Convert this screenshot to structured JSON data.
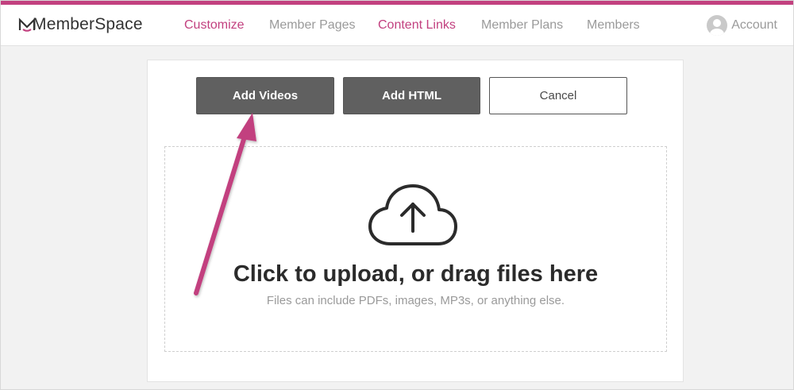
{
  "brand": {
    "name": "MemberSpace",
    "accent_color": "#c2407f"
  },
  "nav": {
    "items": [
      {
        "label": "Customize",
        "active": true
      },
      {
        "label": "Member Pages",
        "active": false
      },
      {
        "label": "Content Links",
        "active": true
      },
      {
        "label": "Member Plans",
        "active": false
      },
      {
        "label": "Members",
        "active": false
      }
    ],
    "account_label": "Account",
    "account_icon": "user-avatar-icon"
  },
  "actions": {
    "add_videos_label": "Add Videos",
    "add_html_label": "Add HTML",
    "cancel_label": "Cancel"
  },
  "upload": {
    "icon": "cloud-upload-icon",
    "title": "Click to upload, or drag files here",
    "subtitle": "Files can include PDFs, images, MP3s, or anything else."
  },
  "annotation": {
    "arrow_color": "#c2407f"
  }
}
